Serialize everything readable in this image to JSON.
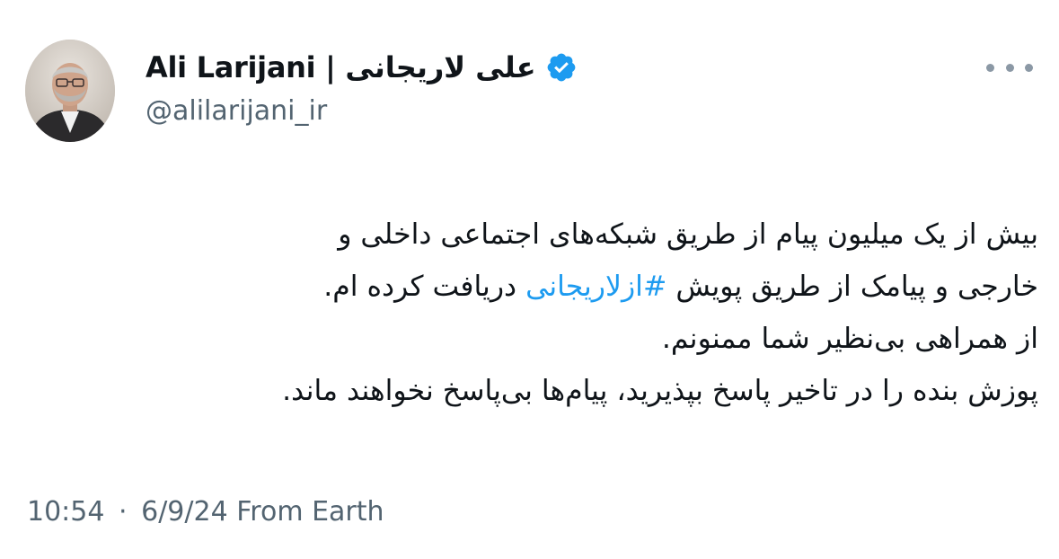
{
  "author": {
    "display_name": "Ali Larijani | علی لاریجانی",
    "handle": "@alilarijani_ir",
    "verified": true,
    "verified_color": "#1d9bf0"
  },
  "icons": {
    "more": "more-horizontal-icon",
    "verified": "verified-badge-icon"
  },
  "tweet": {
    "line1": "بیش از یک میلیون پیام از طریق شبکه‌های اجتماعی داخلی و",
    "line2_prefix": "خارجی و پیامک از طریق پویش ",
    "hashtag": "#ازلاریجانی",
    "line2_suffix": " دریافت کرده ام.",
    "line3": "از همراهی بی‌نظیر شما ممنونم.",
    "line4": "پوزش بنده را در تاخیر پاسخ بپذیرید، پیام‌ها بی‌پاسخ نخواهند ماند.",
    "hashtag_color": "#1d9bf0"
  },
  "meta": {
    "time": "10:54",
    "separator": "·",
    "date": "6/9/24",
    "location": "From Earth"
  }
}
